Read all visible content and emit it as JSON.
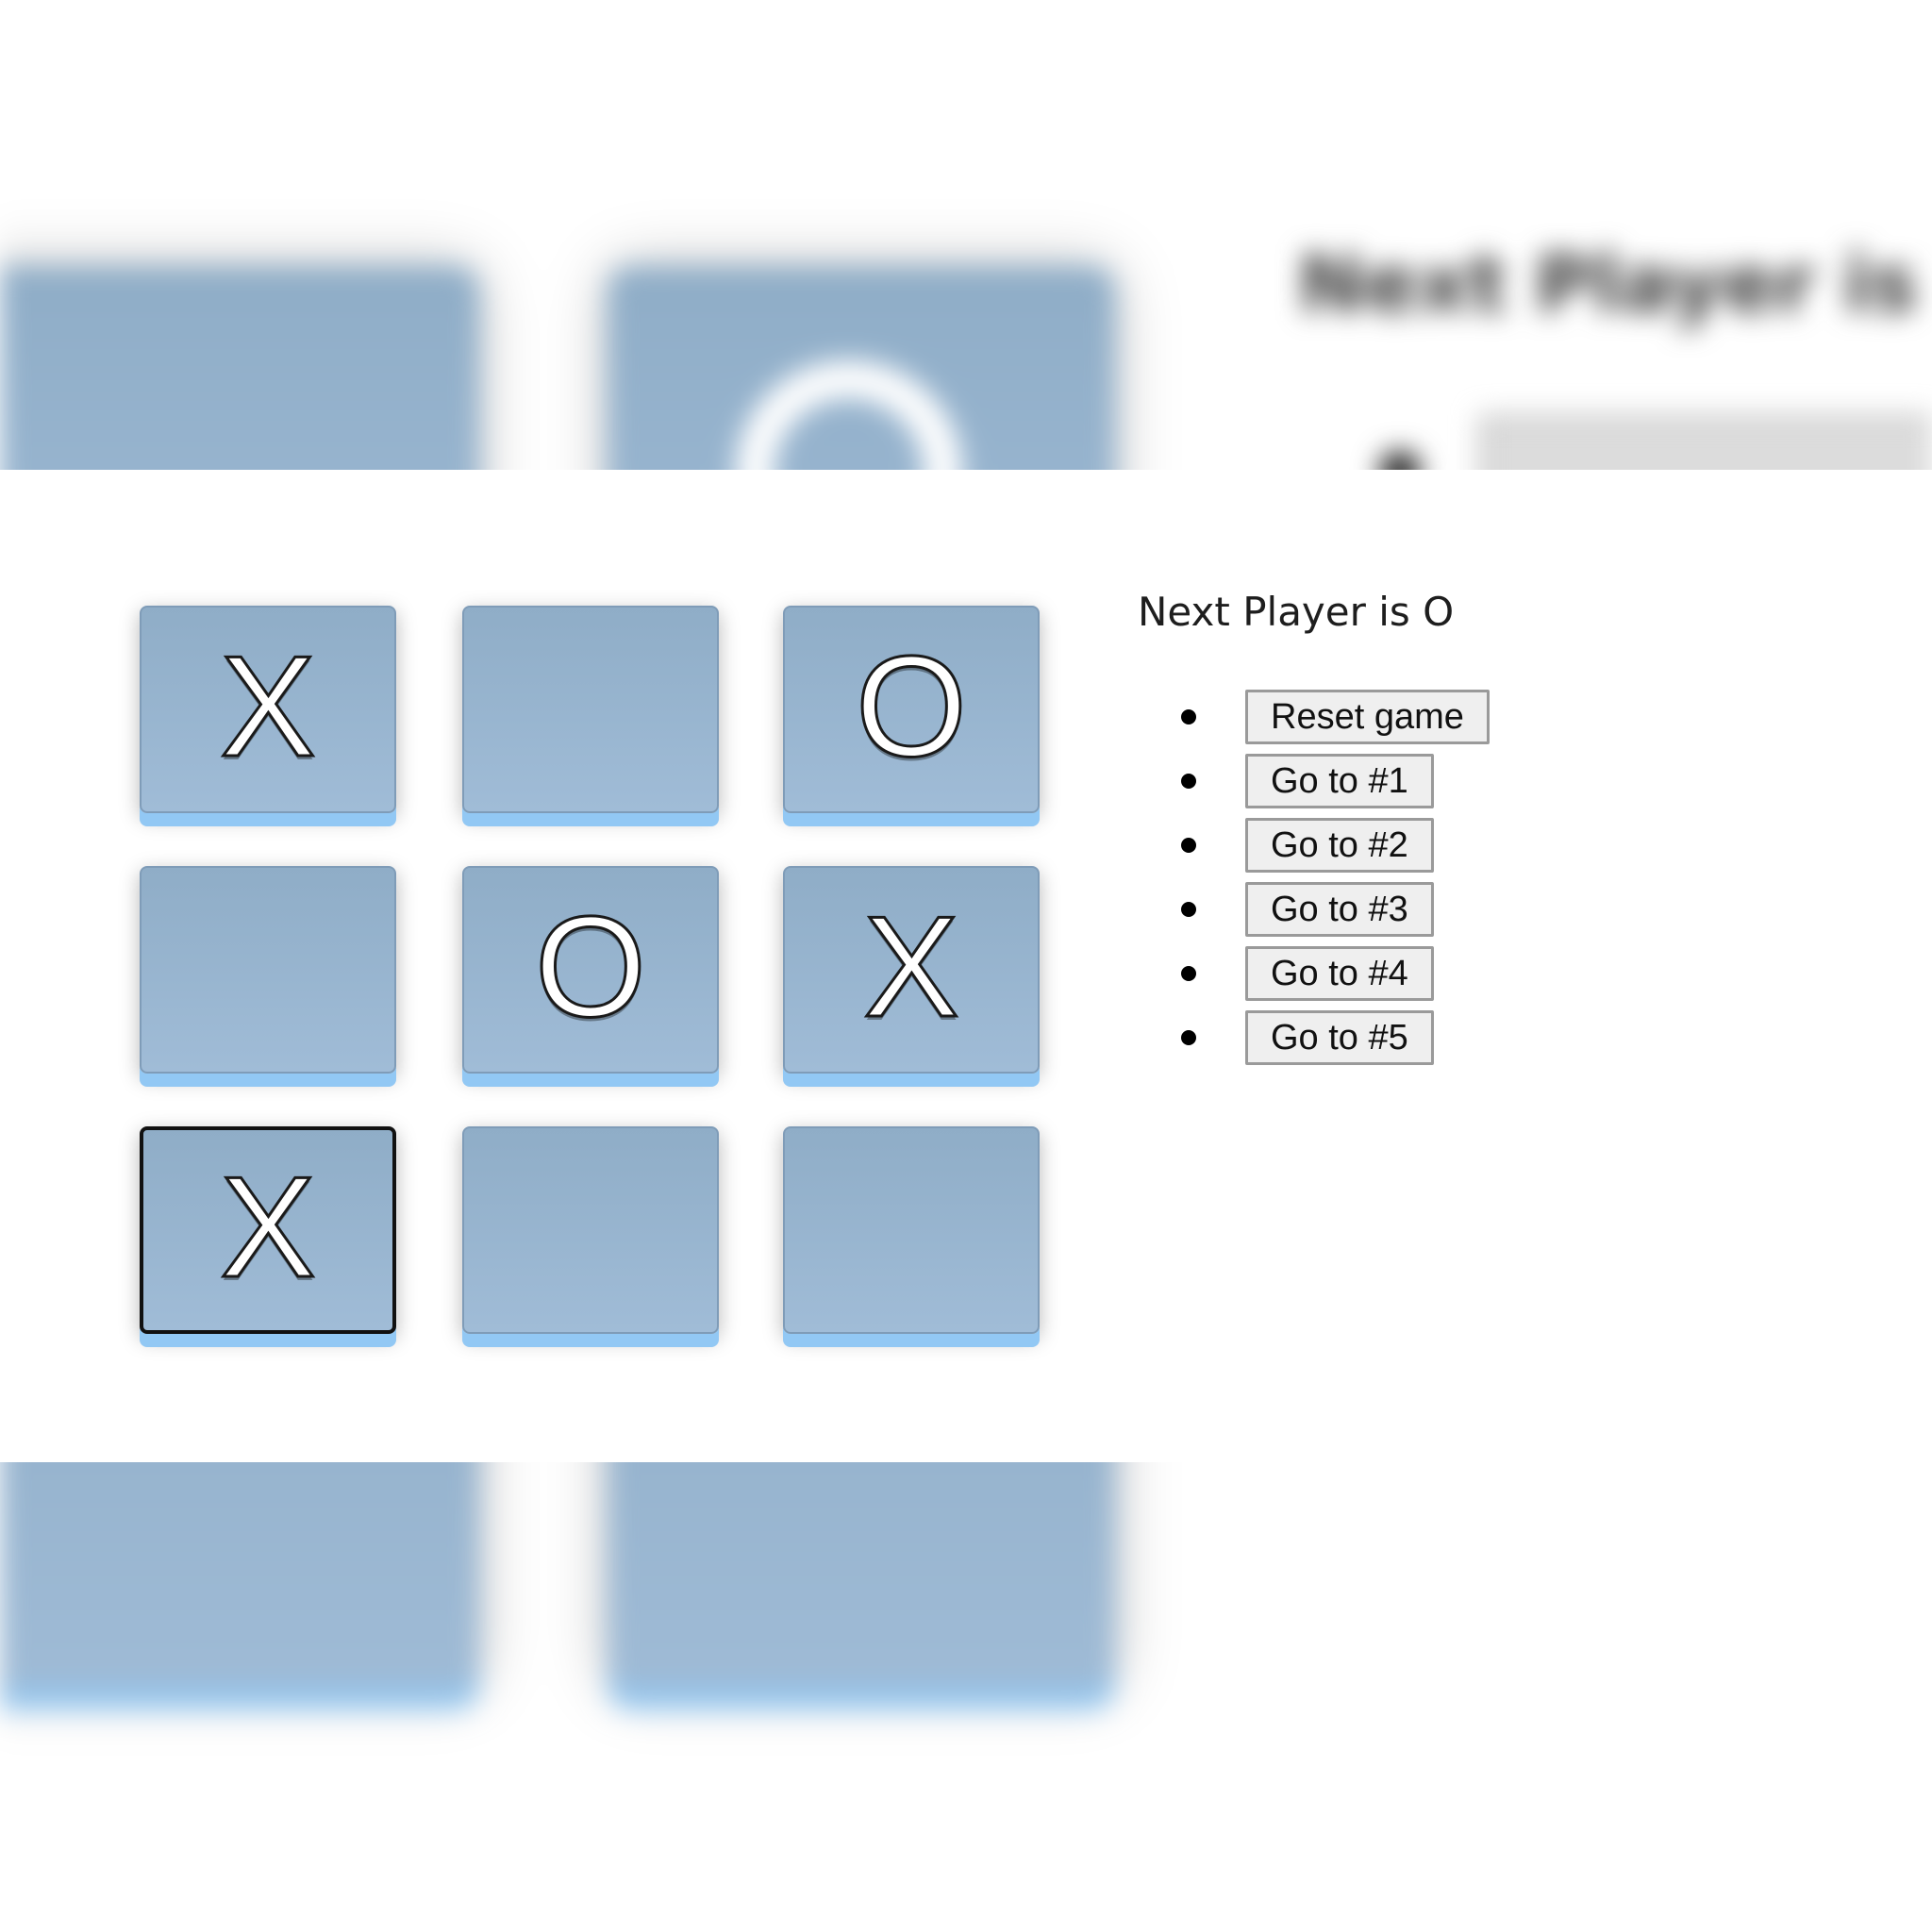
{
  "status": {
    "text": "Next Player is O",
    "background_echo_text": "Next Player is O"
  },
  "board": {
    "cells": [
      {
        "value": "X",
        "selected": false
      },
      {
        "value": "",
        "selected": false
      },
      {
        "value": "O",
        "selected": false
      },
      {
        "value": "",
        "selected": false
      },
      {
        "value": "O",
        "selected": false
      },
      {
        "value": "X",
        "selected": false
      },
      {
        "value": "X",
        "selected": true
      },
      {
        "value": "",
        "selected": false
      },
      {
        "value": "",
        "selected": false
      }
    ]
  },
  "history": {
    "moves": [
      {
        "label": "Reset game"
      },
      {
        "label": "Go to #1"
      },
      {
        "label": "Go to #2"
      },
      {
        "label": "Go to #3"
      },
      {
        "label": "Go to #4"
      },
      {
        "label": "Go to #5"
      }
    ]
  },
  "colors": {
    "tile": "#9ab5d0",
    "tile_shadow": "#92c8f4",
    "mark": "#ffffff",
    "selected_border": "#111111"
  }
}
